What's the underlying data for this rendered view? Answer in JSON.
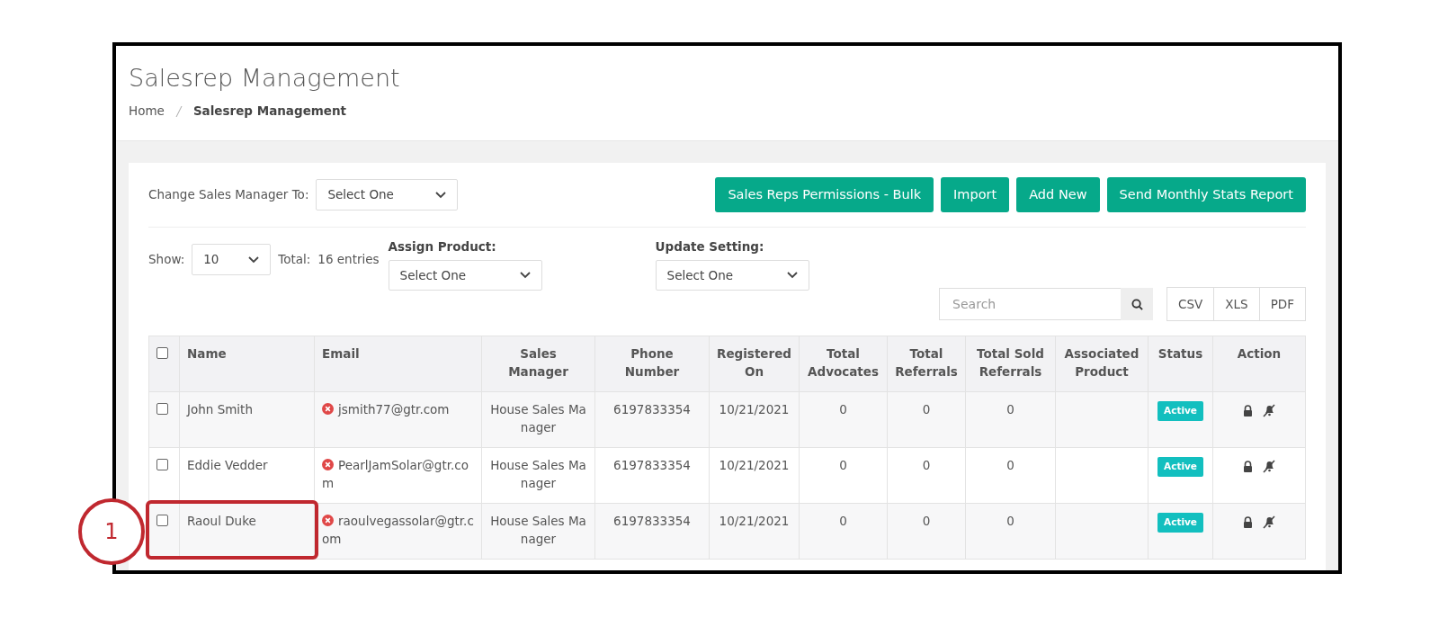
{
  "page": {
    "title": "Salesrep Management",
    "breadcrumb": [
      {
        "label": "Home",
        "current": false
      },
      {
        "label": "Salesrep Management",
        "current": true
      }
    ]
  },
  "toolbar": {
    "manager_label": "Change Sales Manager To:",
    "manager_select": "Select One",
    "buttons": [
      "Sales Reps Permissions - Bulk",
      "Import",
      "Add New",
      "Send Monthly Stats Report"
    ]
  },
  "filters": {
    "show_label": "Show:",
    "show_value": "10",
    "total_label": "Total:",
    "total_value": "16 entries",
    "assign_label": "Assign Product:",
    "assign_value": "Select One",
    "update_label": "Update Setting:",
    "update_value": "Select One",
    "search_placeholder": "Search",
    "export_buttons": [
      "CSV",
      "XLS",
      "PDF"
    ]
  },
  "table": {
    "select_all_checked": false,
    "columns": [
      "Name",
      "Email",
      "Sales Manager",
      "Phone Number",
      "Registered On",
      "Total Advocates",
      "Total Referrals",
      "Total Sold Referrals",
      "Associated Product",
      "Status",
      "Action"
    ],
    "rows": [
      {
        "checked": false,
        "highlighted": false,
        "name": "John Smith",
        "email": "jsmith77@gtr.com",
        "email_verified": false,
        "sales_manager": "House Sales Manager",
        "phone": "6197833354",
        "registered_on": "10/21/2021",
        "total_advocates": "0",
        "total_referrals": "0",
        "total_sold_referrals": "0",
        "status": "Active"
      },
      {
        "checked": false,
        "highlighted": false,
        "name": "Eddie Vedder",
        "email": "PearlJamSolar@gtr.com",
        "email_verified": false,
        "sales_manager": "House Sales Manager",
        "phone": "6197833354",
        "registered_on": "10/21/2021",
        "total_advocates": "0",
        "total_referrals": "0",
        "total_sold_referrals": "0",
        "status": "Active"
      },
      {
        "checked": false,
        "highlighted": true,
        "name": "Raoul Duke",
        "email": "raoulvegassolar@gtr.com",
        "email_verified": false,
        "sales_manager": "House Sales Manager",
        "phone": "6197833354",
        "registered_on": "10/21/2021",
        "total_advocates": "0",
        "total_referrals": "0",
        "total_sold_referrals": "0",
        "status": "Active"
      }
    ]
  },
  "annotation": {
    "label": "1"
  }
}
